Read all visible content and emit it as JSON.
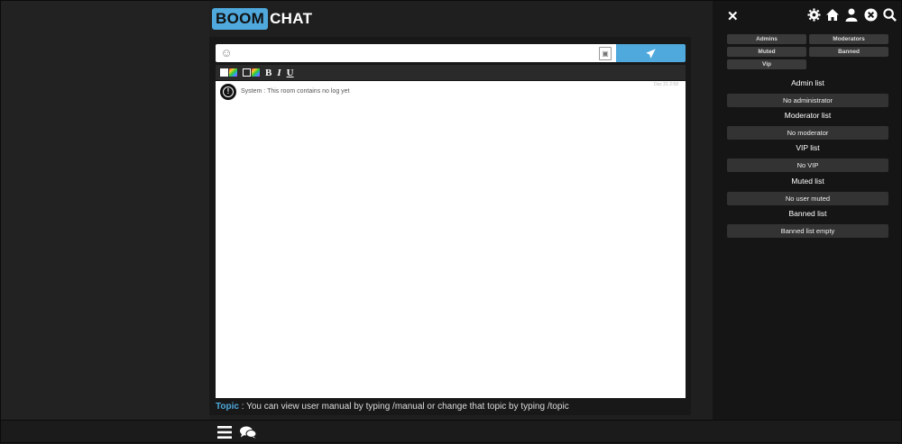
{
  "logo": {
    "part1": "BOOM",
    "part2": "CHAT"
  },
  "composer": {
    "placeholder": "",
    "emoji_icon": "smiley-icon",
    "image_icon": "image-icon",
    "send_icon": "paper-plane-icon"
  },
  "toolbar": {
    "bold": "B",
    "italic": "I",
    "underline": "U"
  },
  "log": {
    "sender": "System",
    "separator": " : ",
    "message": "This room contains no log yet",
    "date": "Dec 21 2:58"
  },
  "topic": {
    "label": "Topic",
    "separator": " : ",
    "text": "You can view user manual by typing /manual or change that topic by typing /topic"
  },
  "right_panel": {
    "close_icon": "close-x-icon",
    "icons": [
      "gear-icon",
      "home-icon",
      "user-icon",
      "x-circle-icon",
      "search-icon"
    ],
    "categories": [
      "Admins",
      "Moderators",
      "Muted",
      "Banned",
      "Vip"
    ],
    "lists": [
      {
        "title": "Admin list",
        "empty": "No administrator"
      },
      {
        "title": "Moderator list",
        "empty": "No moderator"
      },
      {
        "title": "VIP list",
        "empty": "No VIP"
      },
      {
        "title": "Muted list",
        "empty": "No user muted"
      },
      {
        "title": "Banned list",
        "empty": "Banned list empty"
      }
    ]
  },
  "bottom_bar": {
    "icons": [
      "menu-icon",
      "chat-bubbles-icon"
    ]
  },
  "colors": {
    "accent": "#4fa9dd",
    "background": "#1f1f1f",
    "panel": "#151515"
  }
}
